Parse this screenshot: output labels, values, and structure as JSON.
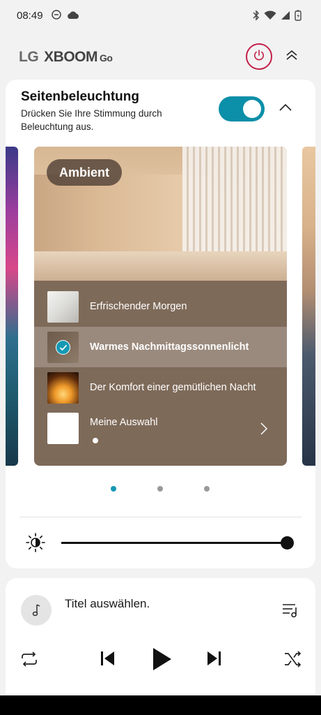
{
  "status_bar": {
    "time": "08:49",
    "left_icons": [
      "do-not-disturb-icon",
      "cloud-icon"
    ],
    "right_icons": [
      "bluetooth-icon",
      "wifi-icon",
      "signal-icon",
      "battery-icon"
    ]
  },
  "header": {
    "brand_lg": "LG",
    "brand_xboom": "XBOOM",
    "brand_go": "Go",
    "power_icon": "power-icon",
    "collapse_icon": "double-chevron-up-icon",
    "accent_color": "#c4204a"
  },
  "lighting": {
    "title": "Seitenbeleuchtung",
    "description": "Drücken Sie Ihre Stimmung durch Beleuchtung aus.",
    "toggle_on": true,
    "toggle_color": "#0c8fa8",
    "collapse_icon": "chevron-up-icon",
    "mood": {
      "badge": "Ambient",
      "options": [
        {
          "label": "Erfrischender Morgen",
          "selected": false
        },
        {
          "label": "Warmes Nachmittagssonnenlicht",
          "selected": true
        },
        {
          "label": "Der Komfort einer gemütlichen Nacht",
          "selected": false
        },
        {
          "label": "Meine Auswahl",
          "selected": false
        }
      ]
    },
    "pages": {
      "count": 3,
      "active": 0
    },
    "brightness": {
      "icon": "brightness-icon",
      "level": 1.0
    }
  },
  "player": {
    "track_title": "Titel auswählen.",
    "icons": [
      "music-note-icon",
      "playlist-icon",
      "repeat-icon",
      "skip-previous-icon",
      "play-icon",
      "skip-next-icon",
      "shuffle-icon"
    ]
  }
}
